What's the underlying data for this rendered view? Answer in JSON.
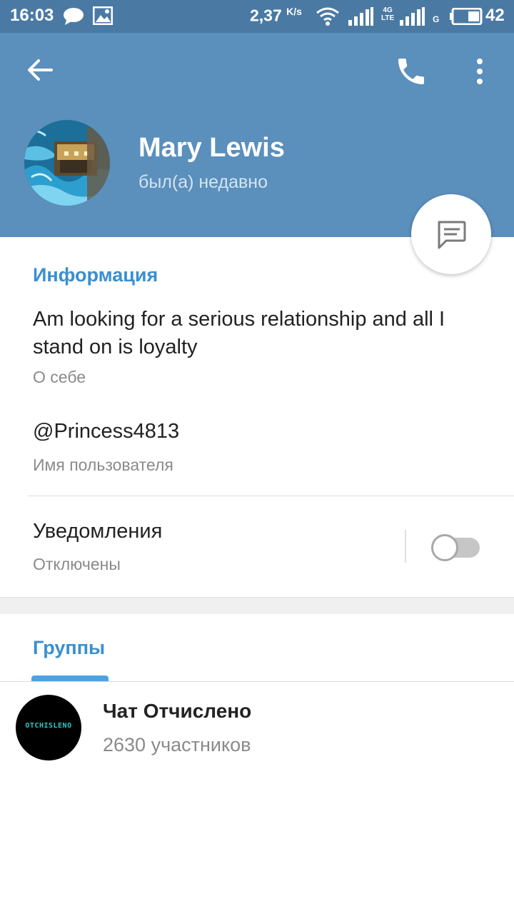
{
  "status_bar": {
    "time": "16:03",
    "speed": "2,37",
    "speed_unit": "K/s",
    "network_lte_top": "4G",
    "network_lte_bottom": "LTE",
    "network_g": "G",
    "battery": "42"
  },
  "header": {
    "name": "Mary Lewis",
    "status": "был(а) недавно",
    "background_color": "#5b8fbc"
  },
  "info": {
    "section_title": "Информация",
    "bio": "Am looking for a serious relationship and all I stand on is loyalty",
    "bio_caption": "О себе",
    "username": "@Princess4813",
    "username_caption": "Имя пользователя",
    "notifications_label": "Уведомления",
    "notifications_value": "Отключены",
    "notifications_enabled": false
  },
  "groups": {
    "section_title": "Группы",
    "items": [
      {
        "name": "Чат Отчислено",
        "members": "2630 участников",
        "avatar_text": "OTCHISLENO"
      }
    ]
  },
  "colors": {
    "accent": "#3a8fd0",
    "status_bar": "#4a7aa3"
  },
  "icons": [
    "message-icon",
    "image-icon",
    "wifi-icon",
    "signal-icon",
    "battery-icon",
    "back-arrow-icon",
    "phone-icon",
    "more-vert-icon",
    "chat-bubble-icon"
  ]
}
